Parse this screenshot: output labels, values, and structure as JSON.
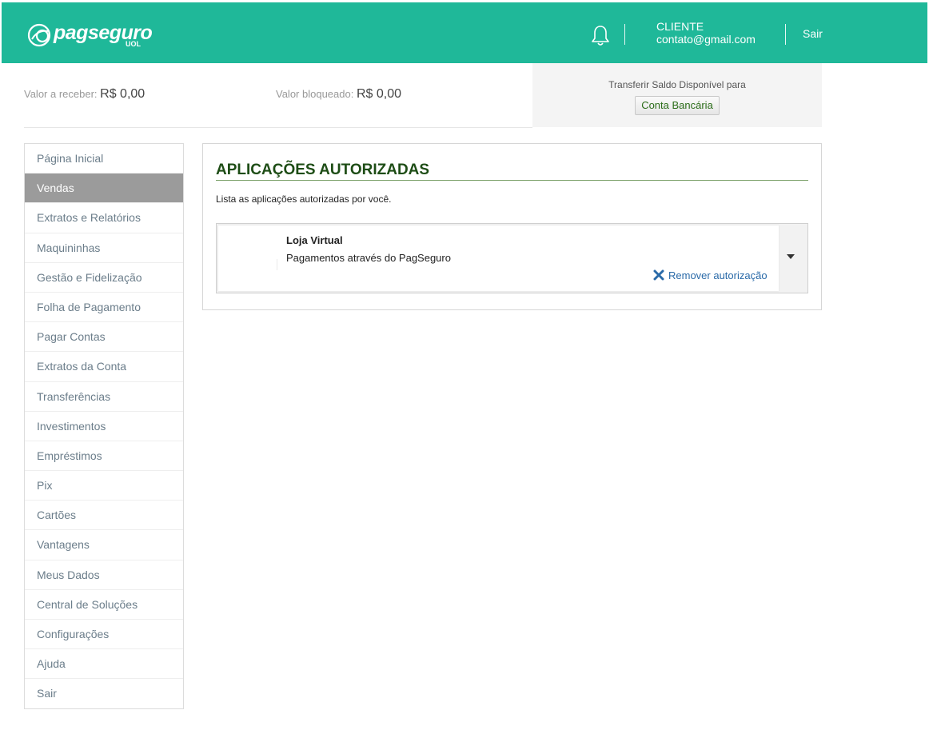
{
  "header": {
    "logo_text": "pagseguro",
    "logo_sub": "UOL",
    "client_label": "CLIENTE",
    "client_email": "contato@gmail.com",
    "logout_label": "Sair",
    "brand_color": "#1fb899"
  },
  "balances": {
    "receivable_label": "Valor a receber:",
    "receivable_value": "R$ 0,00",
    "blocked_label": "Valor bloqueado:",
    "blocked_value": "R$ 0,00"
  },
  "transfer": {
    "label": "Transferir Saldo Disponível para",
    "button_label": "Conta Bancária"
  },
  "sidebar": {
    "active_index": 1,
    "items": [
      {
        "label": "Página Inicial"
      },
      {
        "label": "Vendas"
      },
      {
        "label": "Extratos e Relatórios"
      },
      {
        "label": "Maquininhas"
      },
      {
        "label": "Gestão e Fidelização"
      },
      {
        "label": "Folha de Pagamento"
      },
      {
        "label": "Pagar Contas"
      },
      {
        "label": "Extratos da Conta"
      },
      {
        "label": "Transferências"
      },
      {
        "label": "Investimentos"
      },
      {
        "label": "Empréstimos"
      },
      {
        "label": "Pix"
      },
      {
        "label": "Cartões"
      },
      {
        "label": "Vantagens"
      },
      {
        "label": "Meus Dados"
      },
      {
        "label": "Central de Soluções"
      },
      {
        "label": "Configurações"
      },
      {
        "label": "Ajuda"
      },
      {
        "label": "Sair"
      }
    ]
  },
  "main": {
    "title": "APLICAÇÕES AUTORIZADAS",
    "description": "Lista as aplicações autorizadas por você.",
    "apps": [
      {
        "name": "Loja Virtual",
        "description": "Pagamentos através do PagSeguro",
        "remove_label": "Remover autorização"
      }
    ]
  },
  "icons": {
    "logo": "pagseguro-logo-icon",
    "notifications": "bell-icon",
    "remove": "close-x-icon",
    "expand": "caret-down-icon"
  }
}
